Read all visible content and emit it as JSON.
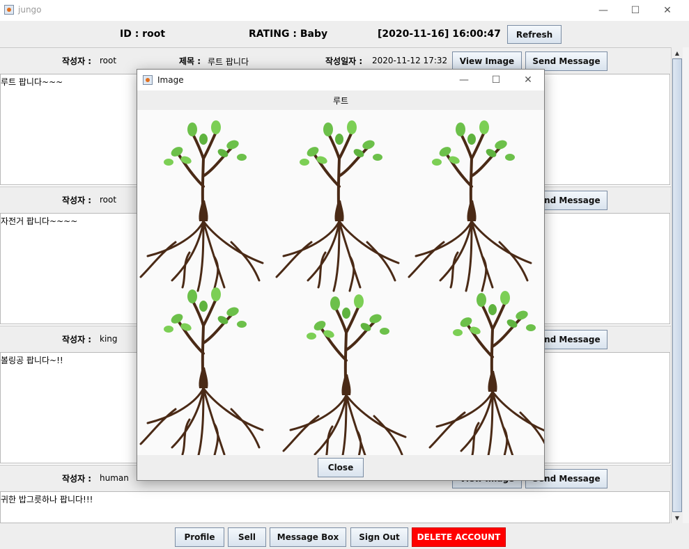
{
  "window": {
    "title": "jungo",
    "minimize": "—",
    "maximize": "☐",
    "close": "✕"
  },
  "header": {
    "id_text": "ID : root",
    "rating_text": "RATING : Baby",
    "datetime_text": "[2020-11-16] 16:00:47",
    "refresh_label": "Refresh"
  },
  "post_labels": {
    "author": "작성자 :",
    "title": "제목 :",
    "date": "작성일자 :",
    "view_image": "View Image",
    "send_message": "Send Message"
  },
  "posts": [
    {
      "author": "root",
      "title": "루트 팝니다",
      "date": "2020-11-12 17:32",
      "body": "루트 팝니다~~~"
    },
    {
      "author": "root",
      "title": "",
      "date": "",
      "body": "자전거 팝니다~~~~"
    },
    {
      "author": "king",
      "title": "",
      "date": "",
      "body": "볼링공 팝니다~!!"
    },
    {
      "author": "human",
      "title": "",
      "date": "",
      "body": "귀한 밥그릇하나 팝니다!!!"
    }
  ],
  "bottom": {
    "profile": "Profile",
    "sell": "Sell",
    "message_box": "Message Box",
    "sign_out": "Sign Out",
    "delete_account": "DELETE ACCOUNT"
  },
  "dialog": {
    "title": "Image",
    "caption": "루트",
    "close_label": "Close",
    "minimize": "—",
    "maximize": "☐",
    "close_x": "✕",
    "image_description": "six tree with roots illustrations"
  },
  "colors": {
    "delete_bg": "#ff0000",
    "panel_bg": "#eeeeee",
    "leaf": "#6cc04a",
    "trunk": "#4a2a16"
  }
}
